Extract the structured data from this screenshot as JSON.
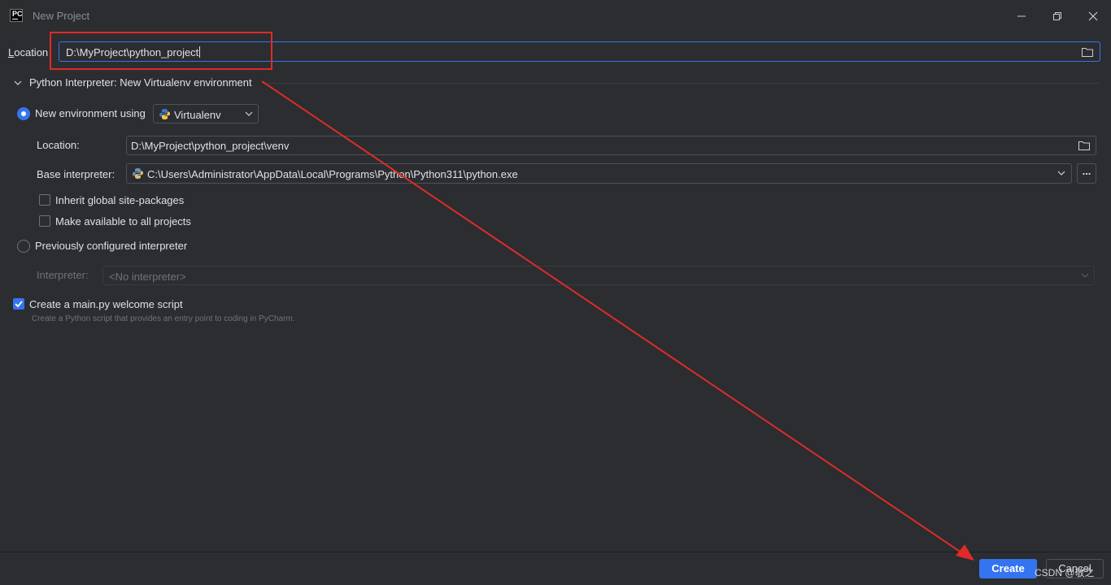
{
  "window": {
    "app_logo_text": "PC",
    "title": "New Project",
    "controls": [
      "minimize-icon",
      "restore-icon",
      "close-icon"
    ]
  },
  "location": {
    "label_prefix": "L",
    "label_rest": "ocation",
    "value": "D:\\MyProject\\python_project"
  },
  "interpreter_section": {
    "title": "Python Interpreter: New Virtualenv environment",
    "new_env": {
      "radio_label": "New environment using",
      "tool_selected": "Virtualenv",
      "location_label": "Location:",
      "location_value": "D:\\MyProject\\python_project\\venv",
      "base_label": "Base interpreter:",
      "base_value": "C:\\Users\\Administrator\\AppData\\Local\\Programs\\Python\\Python311\\python.exe",
      "browse_label": "...",
      "inherit_label": "Inherit global site-packages",
      "make_available_label": "Make available to all projects"
    },
    "previous": {
      "radio_label": "Previously configured interpreter",
      "interpreter_label": "Interpreter:",
      "interpreter_value": "<No interpreter>"
    }
  },
  "welcome_script": {
    "label": "Create a main.py welcome script",
    "hint": "Create a Python script that provides an entry point to coding in PyCharm.",
    "checked": true
  },
  "footer": {
    "create_label": "Create",
    "cancel_label": "Cancel"
  },
  "watermark": "CSDN @敬之",
  "colors": {
    "background": "#2b2d30",
    "accent": "#3574f0",
    "annotation": "#e02a2a"
  }
}
